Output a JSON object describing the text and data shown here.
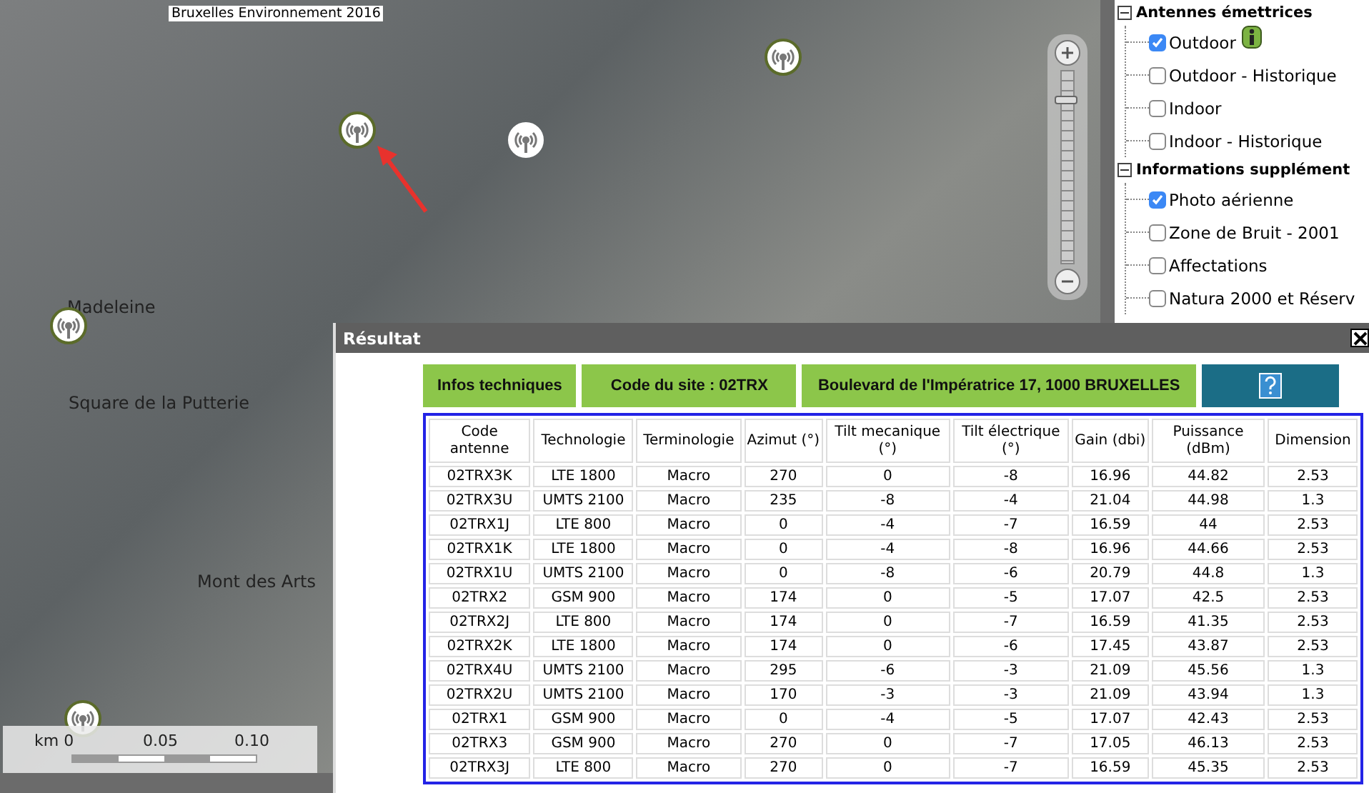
{
  "map": {
    "attribution": "Bruxelles Environnement 2016",
    "places": [
      "Madeleine",
      "Square de la Putterie",
      "Mont des Arts"
    ],
    "scale": {
      "unit": "km 0",
      "ticks": [
        "0.05",
        "0.10"
      ]
    },
    "zoom": {
      "level": 0.85
    }
  },
  "layers": [
    {
      "label": "Antennes émettrices",
      "expanded": true,
      "items": [
        {
          "label": "Outdoor",
          "checked": true,
          "info": true
        },
        {
          "label": "Outdoor - Historique",
          "checked": false,
          "info": false
        },
        {
          "label": "Indoor",
          "checked": false,
          "info": false
        },
        {
          "label": "Indoor - Historique",
          "checked": false,
          "info": false
        }
      ]
    },
    {
      "label": "Informations supplément",
      "expanded": true,
      "items": [
        {
          "label": "Photo aérienne",
          "checked": true,
          "info": false
        },
        {
          "label": "Zone de Bruit - 2001",
          "checked": false,
          "info": false
        },
        {
          "label": "Affectations",
          "checked": false,
          "info": false
        },
        {
          "label": "Natura 2000 et Réserv",
          "checked": false,
          "info": false
        }
      ]
    }
  ],
  "result": {
    "title": "Résultat",
    "tabs": [
      "Infos techniques",
      "Code du site : 02TRX",
      "Boulevard de l'Impératrice 17, 1000 BRUXELLES"
    ],
    "table": {
      "columns": [
        "Code antenne",
        "Technologie",
        "Terminologie",
        "Azimut (°)",
        "Tilt mecanique (°)",
        "Tilt électrique (°)",
        "Gain (dbi)",
        "Puissance (dBm)",
        "Dimension"
      ],
      "rows": [
        [
          "02TRX3K",
          "LTE 1800",
          "Macro",
          "270",
          "0",
          "-8",
          "16.96",
          "44.82",
          "2.53"
        ],
        [
          "02TRX3U",
          "UMTS 2100",
          "Macro",
          "235",
          "-8",
          "-4",
          "21.04",
          "44.98",
          "1.3"
        ],
        [
          "02TRX1J",
          "LTE 800",
          "Macro",
          "0",
          "-4",
          "-7",
          "16.59",
          "44",
          "2.53"
        ],
        [
          "02TRX1K",
          "LTE 1800",
          "Macro",
          "0",
          "-4",
          "-8",
          "16.96",
          "44.66",
          "2.53"
        ],
        [
          "02TRX1U",
          "UMTS 2100",
          "Macro",
          "0",
          "-8",
          "-6",
          "20.79",
          "44.8",
          "1.3"
        ],
        [
          "02TRX2",
          "GSM 900",
          "Macro",
          "174",
          "0",
          "-5",
          "17.07",
          "42.5",
          "2.53"
        ],
        [
          "02TRX2J",
          "LTE 800",
          "Macro",
          "174",
          "0",
          "-7",
          "16.59",
          "41.35",
          "2.53"
        ],
        [
          "02TRX2K",
          "LTE 1800",
          "Macro",
          "174",
          "0",
          "-6",
          "17.45",
          "43.87",
          "2.53"
        ],
        [
          "02TRX4U",
          "UMTS 2100",
          "Macro",
          "295",
          "-6",
          "-3",
          "21.09",
          "45.56",
          "1.3"
        ],
        [
          "02TRX2U",
          "UMTS 2100",
          "Macro",
          "170",
          "-3",
          "-3",
          "21.09",
          "43.94",
          "1.3"
        ],
        [
          "02TRX1",
          "GSM 900",
          "Macro",
          "0",
          "-4",
          "-5",
          "17.07",
          "42.43",
          "2.53"
        ],
        [
          "02TRX3",
          "GSM 900",
          "Macro",
          "270",
          "0",
          "-7",
          "17.05",
          "46.13",
          "2.53"
        ],
        [
          "02TRX3J",
          "LTE 800",
          "Macro",
          "270",
          "0",
          "-7",
          "16.59",
          "45.35",
          "2.53"
        ]
      ]
    }
  }
}
